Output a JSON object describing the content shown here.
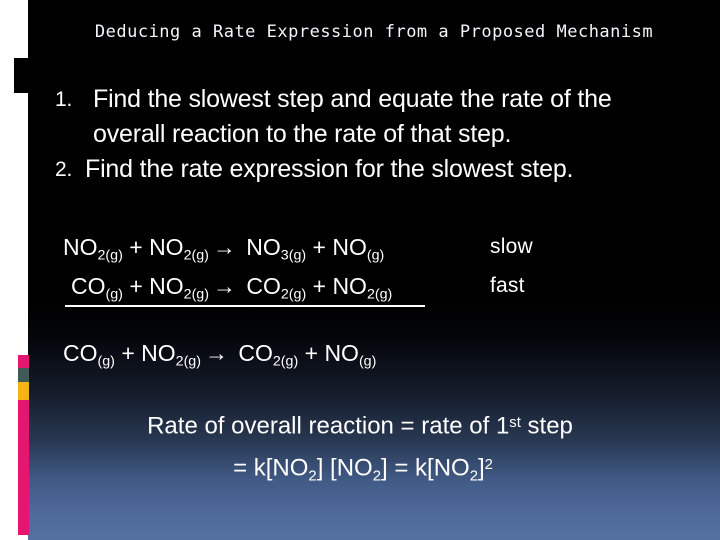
{
  "slide": {
    "title": "Deducing a Rate Expression from a Proposed Mechanism",
    "steps": [
      {
        "num": "1.",
        "text": "Find the slowest step and equate the rate of the overall reaction to the rate of that step."
      },
      {
        "num": "2.",
        "text": "Find the rate expression for the slowest step."
      }
    ],
    "mechanism": {
      "steps": [
        {
          "reactant_1": "NO",
          "reactant_1_sub": "2(g)",
          "plus": "+",
          "reactant_2": "NO",
          "reactant_2_sub": "2(g)",
          "arrow": "→",
          "product_1": "NO",
          "product_1_sub": "3(g)",
          "plus_2": "+",
          "product_2": "NO",
          "product_2_sub": "(g)",
          "label": "slow"
        },
        {
          "reactant_1": "CO",
          "reactant_1_sub": "(g)",
          "plus": "+",
          "reactant_2": "NO",
          "reactant_2_sub": "2(g)",
          "arrow": "→",
          "product_1": "CO",
          "product_1_sub": "2(g)",
          "plus_2": "+",
          "product_2": "NO",
          "product_2_sub": "2(g)",
          "label": "fast"
        }
      ],
      "overall": {
        "reactant_1": "CO",
        "reactant_1_sub": "(g)",
        "plus": "+",
        "reactant_2": "NO",
        "reactant_2_sub": "2(g)",
        "arrow": "→",
        "product_1": "CO",
        "product_1_sub": "2(g)",
        "plus_2": "+",
        "product_2": "NO",
        "product_2_sub": "(g)"
      }
    },
    "conclusion": {
      "line1_prefix": "Rate of overall reaction = rate of 1",
      "line1_sup": "st",
      "line1_suffix": " step",
      "line2_a": "= k[NO",
      "line2_sub_a": "2",
      "line2_b": "] [NO",
      "line2_sub_b": "2",
      "line2_c": "] = k[NO",
      "line2_sub_c": "2",
      "line2_d": "]",
      "line2_sup": "2"
    },
    "colors": {
      "background_top": "#000000",
      "background_bottom": "#5471a0",
      "rail_white": "#ffffff",
      "rail_pink": "#e3176f",
      "rail_teal": "#3f5a57",
      "rail_yellow": "#f5b318",
      "text": "#ffffff"
    }
  }
}
